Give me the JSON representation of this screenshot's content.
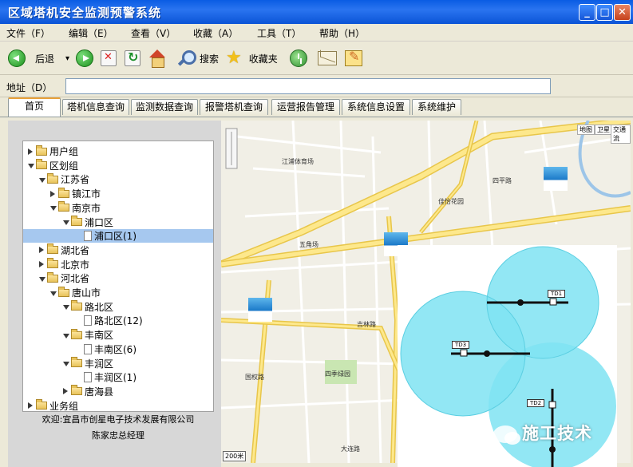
{
  "window": {
    "title": "区域塔机安全监测预警系统",
    "controls": [
      "_",
      "□",
      "✕"
    ]
  },
  "menu": [
    "文件（F）",
    "编辑（E）",
    "查看（V）",
    "收藏（A）",
    "工具（T）",
    "帮助（H）"
  ],
  "toolbar": {
    "back_label": "后退",
    "search_label": "搜索",
    "favorites_label": "收藏夹",
    "back_dropdown": "▾"
  },
  "address": {
    "label": "地址（D）",
    "value": ""
  },
  "tabs": [
    "首页",
    "塔机信息查询",
    "监测数据查询",
    "报警塔机查询",
    "运营报告管理",
    "系统信息设置",
    "系统维护"
  ],
  "tree": [
    {
      "label": "用户组",
      "level": 0,
      "state": "collapsed"
    },
    {
      "label": "区划组",
      "level": 0,
      "state": "expanded"
    },
    {
      "label": "江苏省",
      "level": 1,
      "state": "expanded"
    },
    {
      "label": "镇江市",
      "level": 2,
      "state": "collapsed"
    },
    {
      "label": "南京市",
      "level": 2,
      "state": "expanded"
    },
    {
      "label": "浦口区",
      "level": 3,
      "state": "expanded"
    },
    {
      "label": "浦口区(1)",
      "level": 4,
      "state": "leaf",
      "selected": true
    },
    {
      "label": "湖北省",
      "level": 1,
      "state": "collapsed"
    },
    {
      "label": "北京市",
      "level": 1,
      "state": "collapsed"
    },
    {
      "label": "河北省",
      "level": 1,
      "state": "expanded"
    },
    {
      "label": "唐山市",
      "level": 2,
      "state": "expanded"
    },
    {
      "label": "路北区",
      "level": 3,
      "state": "expanded"
    },
    {
      "label": "路北区(12)",
      "level": 4,
      "state": "leaf"
    },
    {
      "label": "丰南区",
      "level": 3,
      "state": "expanded"
    },
    {
      "label": "丰南区(6)",
      "level": 4,
      "state": "leaf"
    },
    {
      "label": "丰润区",
      "level": 3,
      "state": "expanded"
    },
    {
      "label": "丰润区(1)",
      "level": 4,
      "state": "leaf"
    },
    {
      "label": "唐海县",
      "level": 3,
      "state": "collapsed"
    },
    {
      "label": "业务组",
      "level": 0,
      "state": "collapsed"
    }
  ],
  "welcome": {
    "line1": "欢迎:宜昌市创星电子技术发展有限公司",
    "line2": "陈家忠总经理"
  },
  "map": {
    "buttons": [
      "地图",
      "卫星",
      "交通流"
    ],
    "labels": [
      "江浦体育场",
      "五角场",
      "四季绿园",
      "佳怡花园",
      "国权路",
      "大连路",
      "四平路",
      "吉林路"
    ],
    "scale": "200米"
  },
  "overlay": {
    "cranes": [
      "TD1",
      "TD3",
      "TD2"
    ]
  },
  "watermark": "施工技术",
  "colors": {
    "titlebar": "#0a5ce3",
    "chrome": "#ece9d8",
    "selection": "#a6c8ef",
    "zone": "#7fe3f2"
  }
}
